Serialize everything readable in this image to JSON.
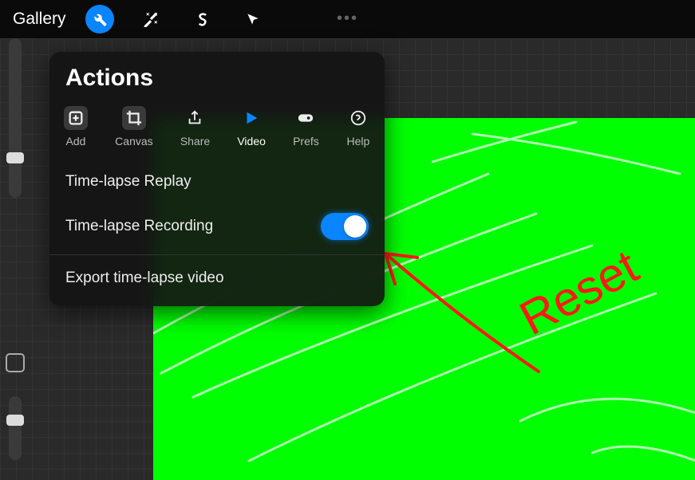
{
  "topbar": {
    "gallery_label": "Gallery",
    "tools": [
      {
        "name": "wrench",
        "active": true
      },
      {
        "name": "wand",
        "active": false
      },
      {
        "name": "s-shape",
        "active": false
      },
      {
        "name": "arrow",
        "active": false
      }
    ]
  },
  "actions_panel": {
    "title": "Actions",
    "tabs": [
      {
        "id": "add",
        "label": "Add"
      },
      {
        "id": "canvas",
        "label": "Canvas"
      },
      {
        "id": "share",
        "label": "Share"
      },
      {
        "id": "video",
        "label": "Video",
        "active": true
      },
      {
        "id": "prefs",
        "label": "Prefs"
      },
      {
        "id": "help",
        "label": "Help"
      }
    ],
    "items": {
      "replay": "Time-lapse Replay",
      "recording": "Time-lapse Recording",
      "recording_on": true,
      "export": "Export time-lapse video"
    }
  },
  "annotation": {
    "text": "Reset",
    "color": "#ff1818"
  },
  "colors": {
    "accent": "#0a84ff",
    "canvas_fill": "#00ff00"
  }
}
